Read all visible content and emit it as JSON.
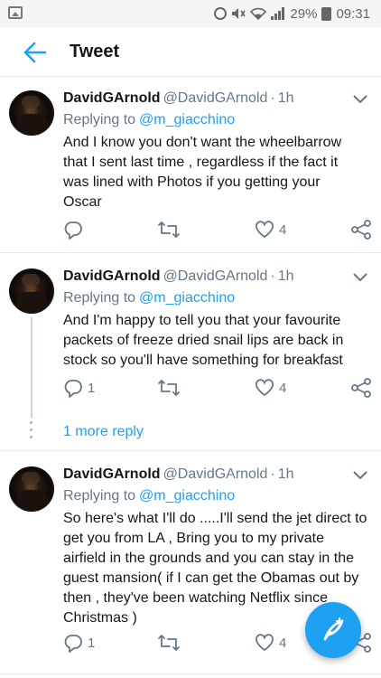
{
  "status_bar": {
    "battery": "29%",
    "time": "09:31"
  },
  "header": {
    "title": "Tweet"
  },
  "tweets": [
    {
      "name": "DavidGArnold",
      "handle": "@DavidGArnold",
      "separator": "·",
      "time": "1h",
      "replying_label": "Replying to",
      "replying_to": "@m_giacchino",
      "text": "And I know you don't want the wheelbarrow\nthat I sent last time , regardless if the fact it\nwas lined with      Photos if you getting your\nOscar",
      "reply_count": "",
      "like_count": "4"
    },
    {
      "name": "DavidGArnold",
      "handle": "@DavidGArnold",
      "separator": "·",
      "time": "1h",
      "replying_label": "Replying to",
      "replying_to": "@m_giacchino",
      "text": "And I'm happy to tell you that your favourite\npackets of freeze dried snail lips are back in\nstock so you'll have something  for breakfast",
      "reply_count": "1",
      "like_count": "4"
    },
    {
      "name": "DavidGArnold",
      "handle": "@DavidGArnold",
      "separator": "·",
      "time": "1h",
      "replying_label": "Replying to",
      "replying_to": "@m_giacchino",
      "text": "So here's what I'll do .....I'll send the jet direct to\nget you from LA , Bring you to my private\nairfield in the grounds and you can stay in the\nguest mansion( if I can get the Obamas out by\nthen , they've been watching Netflix since\nChristmas )",
      "reply_count": "1",
      "like_count": "4"
    }
  ],
  "more_replies": {
    "label": "1 more reply"
  },
  "icons": {
    "back": "back-arrow-icon",
    "menu": "chevron-down-icon",
    "reply": "reply-icon",
    "retweet": "retweet-icon",
    "like": "heart-icon",
    "share": "share-icon",
    "compose": "compose-feather-icon"
  },
  "colors": {
    "accent": "#1da1f2",
    "secondary_text": "#657786",
    "divider": "#e6ecf0"
  }
}
